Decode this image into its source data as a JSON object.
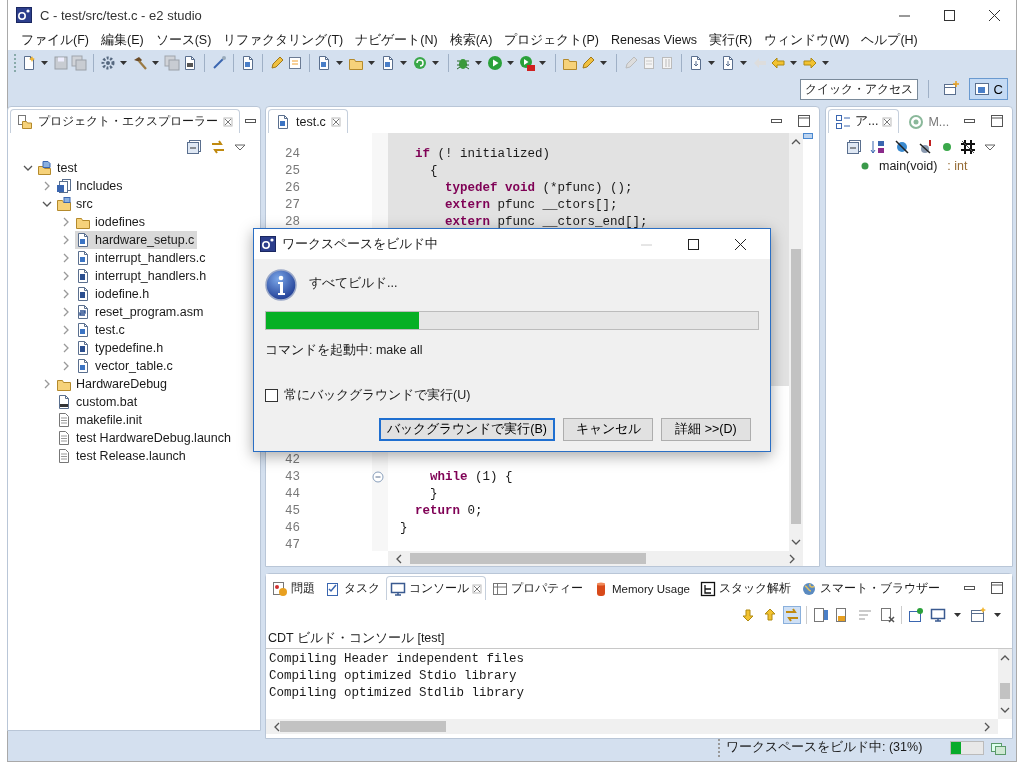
{
  "window": {
    "title": "C - test/src/test.c - e2 studio"
  },
  "menu": [
    "ファイル(F)",
    "編集(E)",
    "ソース(S)",
    "リファクタリング(T)",
    "ナビゲート(N)",
    "検索(A)",
    "プロジェクト(P)",
    "Renesas Views",
    "実行(R)",
    "ウィンドウ(W)",
    "ヘルプ(H)"
  ],
  "quick_access": {
    "placeholder": "クイック・アクセス"
  },
  "perspectives": [
    {
      "label": "C",
      "selected": true
    }
  ],
  "project_explorer": {
    "tab": {
      "label": "プロジェクト・エクスプローラー",
      "selected": true
    },
    "tree": [
      {
        "label": "test",
        "kind": "project",
        "expanded": true,
        "selected": false,
        "children": [
          {
            "label": "Includes",
            "kind": "library",
            "expanded": false,
            "selected": false
          },
          {
            "label": "src",
            "kind": "source-folder",
            "expanded": true,
            "selected": false,
            "children": [
              {
                "label": "iodefines",
                "kind": "folder",
                "expanded": false,
                "selected": false
              },
              {
                "label": "hardware_setup.c",
                "kind": "c-file",
                "expanded": false,
                "selected": true
              },
              {
                "label": "interrupt_handlers.c",
                "kind": "c-file",
                "expanded": false,
                "selected": false
              },
              {
                "label": "interrupt_handlers.h",
                "kind": "h-file",
                "expanded": false,
                "selected": false
              },
              {
                "label": "iodefine.h",
                "kind": "h-file",
                "expanded": false,
                "selected": false
              },
              {
                "label": "reset_program.asm",
                "kind": "asm-file",
                "expanded": false,
                "selected": false
              },
              {
                "label": "test.c",
                "kind": "c-file",
                "expanded": false,
                "selected": false
              },
              {
                "label": "typedefine.h",
                "kind": "h-file",
                "expanded": false,
                "selected": false
              },
              {
                "label": "vector_table.c",
                "kind": "c-file",
                "expanded": false,
                "selected": false
              }
            ]
          },
          {
            "label": "HardwareDebug",
            "kind": "folder",
            "expanded": false,
            "selected": false
          },
          {
            "label": "custom.bat",
            "kind": "binary-file",
            "selected": false
          },
          {
            "label": "makefile.init",
            "kind": "text-file",
            "selected": false
          },
          {
            "label": "test HardwareDebug.launch",
            "kind": "text-file",
            "selected": false
          },
          {
            "label": "test Release.launch",
            "kind": "text-file",
            "selected": false
          }
        ]
      }
    ]
  },
  "editor": {
    "tab": {
      "label": "test.c",
      "selected": true
    },
    "lines_top": [
      {
        "number": "24",
        "text": "  **if** (! initialized)"
      },
      {
        "number": "25",
        "text": "    {"
      },
      {
        "number": "26",
        "text": "      **typedef** **void** (*pfunc) ();"
      },
      {
        "number": "27",
        "text": "      **extern** pfunc __ctors[];"
      },
      {
        "number": "28",
        "text": "      **extern** pfunc __ctors_end[];"
      }
    ],
    "lines_bottom": [
      {
        "number": "42"
      },
      {
        "number": "43",
        "text": "    **while** (1) {",
        "fold": true
      },
      {
        "number": "44",
        "text": "    }"
      },
      {
        "number": "45",
        "text": "  **return** 0;"
      },
      {
        "number": "46",
        "text": "}"
      },
      {
        "number": "47"
      }
    ]
  },
  "outline": {
    "tabs": [
      {
        "label": "ア...",
        "selected": true
      },
      {
        "label": "M...",
        "selected": false
      }
    ],
    "items": [
      {
        "name": "main(void)",
        "type": ": int"
      }
    ]
  },
  "console": {
    "tabs": [
      {
        "label": "問題",
        "selected": false
      },
      {
        "label": "タスク",
        "selected": false
      },
      {
        "label": "コンソール",
        "selected": true
      },
      {
        "label": "プロパティー",
        "selected": false
      },
      {
        "label": "Memory Usage",
        "selected": false
      },
      {
        "label": "スタック解析",
        "selected": false
      },
      {
        "label": "スマート・ブラウザー",
        "selected": false
      }
    ],
    "title": "CDT ビルド・コンソール [test]",
    "lines": [
      "Compiling Header independent files",
      "Compiling optimized Stdio library",
      "Compiling optimized Stdlib library"
    ]
  },
  "status_bar": {
    "text": "ワークスペースをビルド中: (31%)",
    "level": 0.31
  },
  "dialog": {
    "title": "ワークスペースをビルド中",
    "task": "すべてビルド...",
    "level": 0.31,
    "detail": "コマンドを起動中: make all",
    "checkbox": {
      "label": "常にバックグラウンドで実行(U)",
      "checked": false
    },
    "buttons": [
      {
        "label": "バックグラウンドで実行(B)",
        "default": true
      },
      {
        "label": "キャンセル",
        "default": false
      },
      {
        "label": "詳細 >>(D)",
        "default": false
      }
    ]
  }
}
